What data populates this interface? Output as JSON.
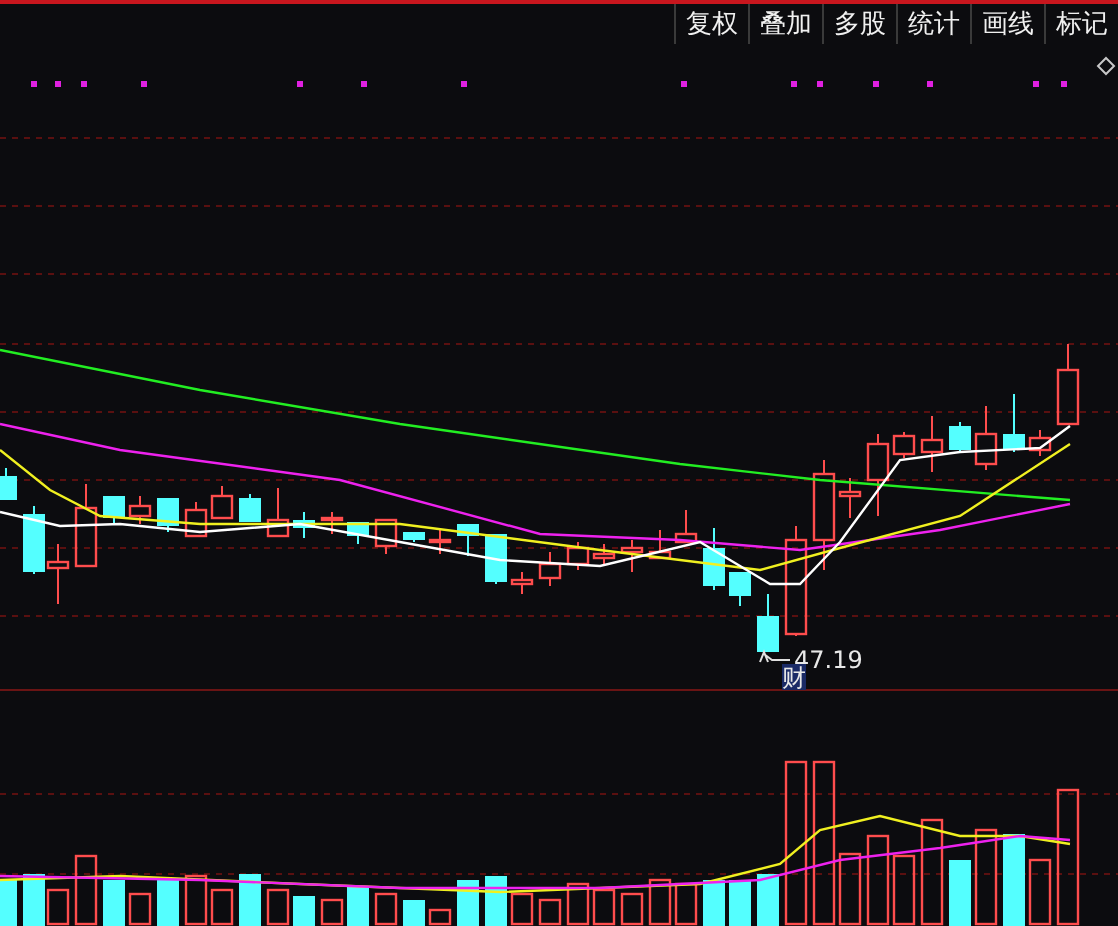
{
  "toolbar": [
    {
      "label": "复权"
    },
    {
      "label": "叠加"
    },
    {
      "label": "多股"
    },
    {
      "label": "统计"
    },
    {
      "label": "画线"
    },
    {
      "label": "标记"
    }
  ],
  "low_price_label": "47.19",
  "event_marker": "财"
}
